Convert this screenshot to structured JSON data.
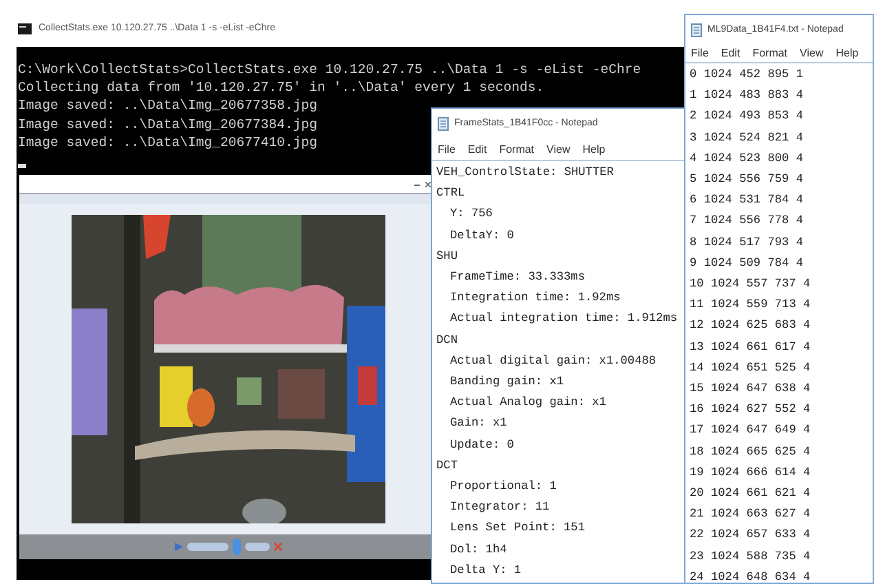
{
  "console": {
    "title": "CollectStats.exe 10.120.27.75 ..\\Data 1 -s -eList -eChre",
    "lines": [
      "C:\\Work\\CollectStats>CollectStats.exe 10.120.27.75 ..\\Data 1 -s -eList -eChre",
      "Collecting data from '10.120.27.75' in '..\\Data' every 1 seconds.",
      "Image saved: ..\\Data\\Img_20677358.jpg",
      "Image saved: ..\\Data\\Img_20677384.jpg",
      "Image saved: ..\\Data\\Img_20677410.jpg"
    ]
  },
  "notepads": [
    {
      "title": "FrameStats_1B41F0cc - Notepad",
      "menu": [
        "File",
        "Edit",
        "Format",
        "View",
        "Help"
      ],
      "lines": [
        {
          "text": "VEH_ControlState: SHUTTER"
        },
        {
          "text": "CTRL",
          "children": [
            {
              "text": "Y: 756"
            },
            {
              "text": "DeltaY: 0"
            }
          ]
        },
        {
          "text": "SHU",
          "children": [
            {
              "text": "FrameTime: 33.333ms"
            },
            {
              "text": "Integration time: 1.92ms"
            },
            {
              "text": "Actual integration time: 1.912ms"
            }
          ]
        },
        {
          "text": "DCN",
          "children": [
            {
              "text": "Actual digital gain: x1.00488"
            },
            {
              "text": "Banding gain: x1"
            },
            {
              "text": "Actual Analog gain: x1"
            },
            {
              "text": "Gain: x1"
            },
            {
              "text": "Update: 0"
            }
          ]
        },
        {
          "text": "DCT",
          "children": [
            {
              "text": "Proportional: 1"
            },
            {
              "text": "Integrator: 11"
            },
            {
              "text": "Lens Set Point: 151"
            },
            {
              "text": "Dol: 1h4"
            },
            {
              "text": "Delta Y: 1"
            }
          ]
        }
      ]
    },
    {
      "title": "ML9Data_1B41F4.txt - Notepad",
      "menu": [
        "File",
        "Edit",
        "Format",
        "View",
        "Help"
      ],
      "lines": [
        {
          "text": "0 1024 452 895 1"
        },
        {
          "text": "1 1024 483 883 4"
        },
        {
          "text": "2 1024 493 853 4"
        },
        {
          "text": "3 1024 524 821 4"
        },
        {
          "text": "4 1024 523 800 4"
        },
        {
          "text": "5 1024 556 759 4"
        },
        {
          "text": "6 1024 531 784 4"
        },
        {
          "text": "7 1024 556 778 4"
        },
        {
          "text": "8 1024 517 793 4"
        },
        {
          "text": "9 1024 509 784 4"
        },
        {
          "text": "10 1024 557 737 4"
        },
        {
          "text": "11 1024 559 713 4"
        },
        {
          "text": "12 1024 625 683 4"
        },
        {
          "text": "13 1024 661 617 4"
        },
        {
          "text": "14 1024 651 525 4"
        },
        {
          "text": "15 1024 647 638 4"
        },
        {
          "text": "16 1024 627 552 4"
        },
        {
          "text": "17 1024 647 649 4"
        },
        {
          "text": "18 1024 665 625 4"
        },
        {
          "text": "19 1024 666 614 4"
        },
        {
          "text": "20 1024 661 621 4"
        },
        {
          "text": "21 1024 663 627 4"
        },
        {
          "text": "22 1024 657 633 4"
        },
        {
          "text": "23 1024 588 735 4"
        },
        {
          "text": "24 1024 648 634 4"
        }
      ]
    }
  ]
}
